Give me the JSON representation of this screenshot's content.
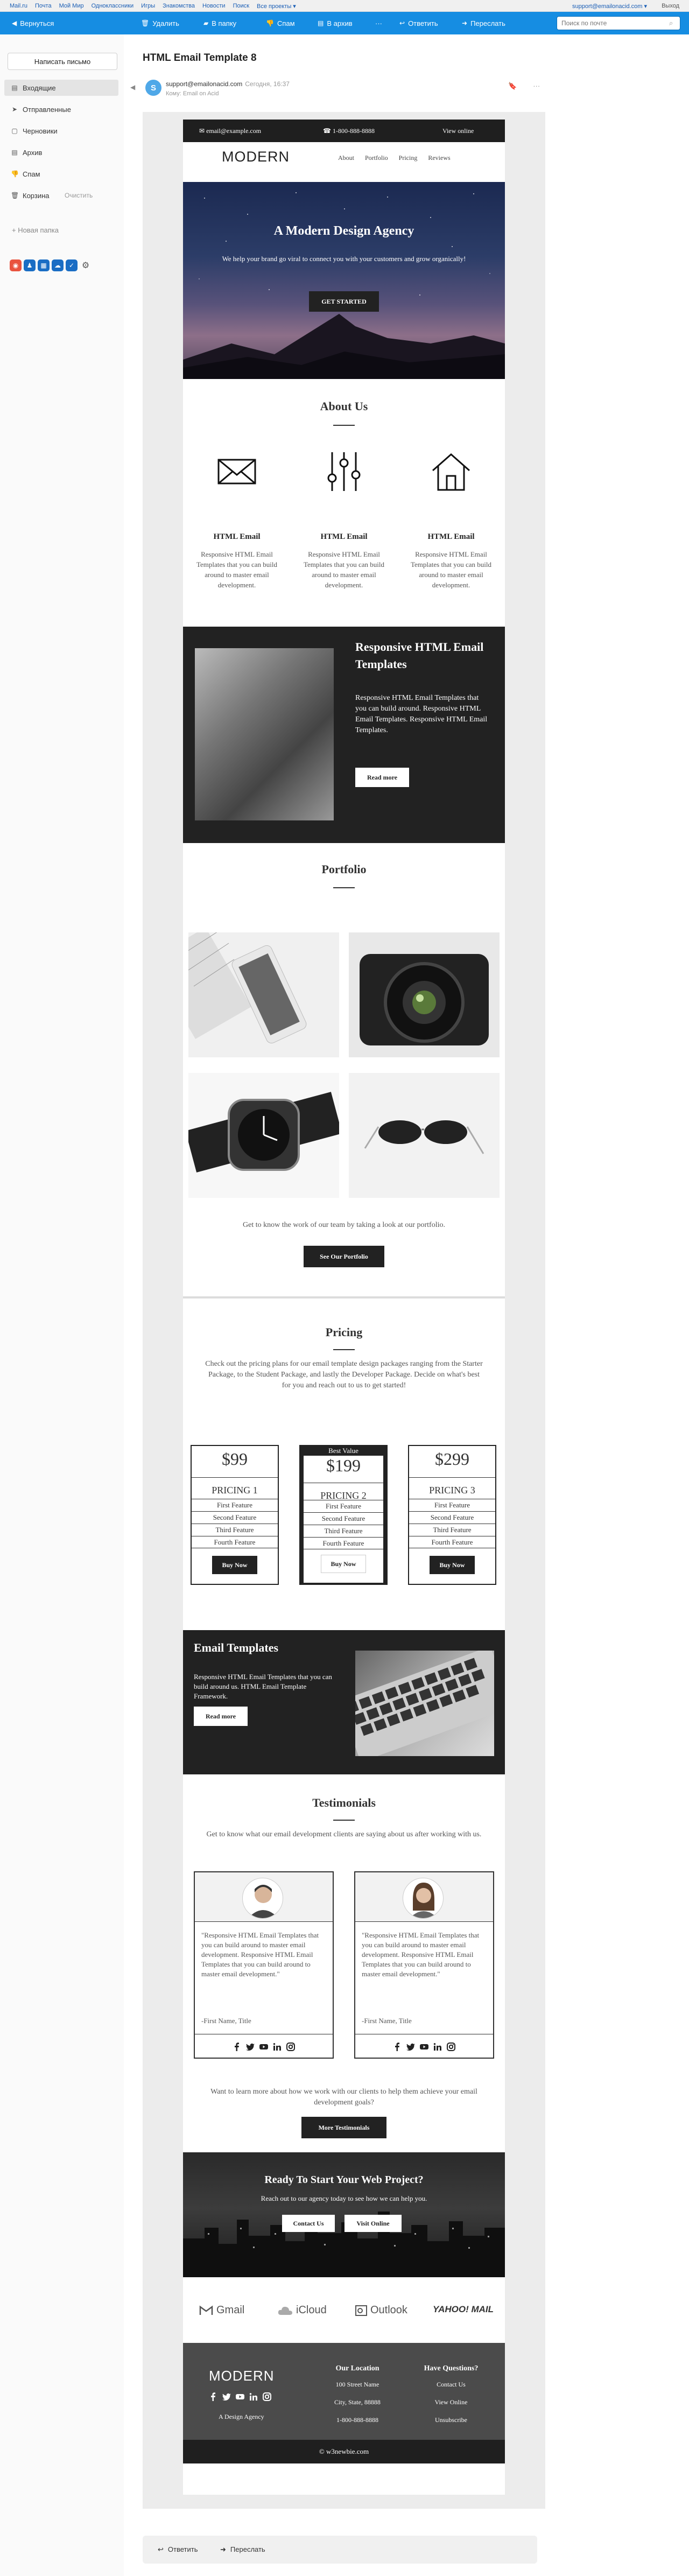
{
  "portal": {
    "links": [
      "Mail.ru",
      "Почта",
      "Мой Мир",
      "Одноклассники",
      "Игры",
      "Знакомства",
      "Новости",
      "Поиск",
      "Все проекты ▾"
    ],
    "user": "support@emailonacid.com ▾",
    "exit": "Выход"
  },
  "toolbar": {
    "back": "Вернуться",
    "delete": "Удалить",
    "to_folder": "В папку",
    "spam": "Спам",
    "archive": "В архив",
    "more": "···",
    "reply": "Ответить",
    "forward": "Переслать",
    "search_placeholder": "Поиск по почте"
  },
  "sidebar": {
    "compose": "Написать письмо",
    "folders": [
      {
        "label": "Входящие",
        "icon": "inbox-icon"
      },
      {
        "label": "Отправленные",
        "icon": "sent-icon"
      },
      {
        "label": "Черновики",
        "icon": "drafts-icon"
      },
      {
        "label": "Архив",
        "icon": "archive-icon"
      },
      {
        "label": "Спам",
        "icon": "spam-icon"
      },
      {
        "label": "Корзина",
        "icon": "trash-icon"
      }
    ],
    "clear": "Очистить",
    "new_folder": "Новая папка"
  },
  "message": {
    "subject": "HTML Email Template 8",
    "avatar_letter": "S",
    "sender": "support@emailonacid.com",
    "date": "Сегодня, 16:37",
    "recipient": "Кому: Email on Acid"
  },
  "email": {
    "topbar": {
      "email": "email@example.com",
      "phone": "1-800-888-8888",
      "view_online": "View online"
    },
    "logo": "MODERN",
    "nav": [
      "About",
      "Portfolio",
      "Pricing",
      "Reviews"
    ],
    "hero": {
      "title": "A Modern Design Agency",
      "text": "We help your brand go viral to connect you with your customers and grow organically!",
      "button": "GET STARTED"
    },
    "about": {
      "title": "About Us",
      "features": [
        {
          "title": "HTML Email",
          "text": "Responsive HTML Email Templates that you can build around to master email development."
        },
        {
          "title": "HTML Email",
          "text": "Responsive HTML Email Templates that you can build around to master email development."
        },
        {
          "title": "HTML Email",
          "text": "Responsive HTML Email Templates that you can build around to master email development."
        }
      ]
    },
    "responsive": {
      "title": "Responsive HTML Email Templates",
      "text": "Responsive HTML Email Templates that you can build around. Responsive HTML Email Templates. Responsive HTML Email Templates.",
      "button": "Read more"
    },
    "portfolio": {
      "title": "Portfolio",
      "text": "Get to know the work of our team by taking a look at our portfolio.",
      "button": "See Our Portfolio"
    },
    "pricing": {
      "title": "Pricing",
      "text": "Check out the pricing plans for our email template design packages ranging from the Starter Package, to the Student Package, and lastly the Developer Package. Decide on what's best for you and reach out to us to get started!",
      "best_value": "Best Value",
      "plans": [
        {
          "price": "$99",
          "name": "PRICING 1",
          "features": [
            "First Feature",
            "Second Feature",
            "Third Feature",
            "Fourth Feature"
          ],
          "button": "Buy Now"
        },
        {
          "price": "$199",
          "name": "PRICING 2",
          "features": [
            "First Feature",
            "Second Feature",
            "Third Feature",
            "Fourth Feature"
          ],
          "button": "Buy Now"
        },
        {
          "price": "$299",
          "name": "PRICING 3",
          "features": [
            "First Feature",
            "Second Feature",
            "Third Feature",
            "Fourth Feature"
          ],
          "button": "Buy Now"
        }
      ]
    },
    "email_templates": {
      "title": "Email Templates",
      "text": "Responsive HTML Email Templates that you can build around us. HTML Email Template Framework.",
      "button": "Read more"
    },
    "testimonials": {
      "title": "Testimonials",
      "text": "Get to know what our email development clients are saying about us after working with us.",
      "cards": [
        {
          "quote": "\"Responsive HTML Email Templates that you can build around to master email development. Responsive HTML Email Templates that you can build around to master email development.\"",
          "who": "-First Name, Title"
        },
        {
          "quote": "\"Responsive HTML Email Templates that you can build around to master email development. Responsive HTML Email Templates that you can build around to master email development.\"",
          "who": "-First Name, Title"
        }
      ],
      "tail": "Want to learn more about how we work with our clients to help them achieve your email development goals?",
      "button": "More Testimonials"
    },
    "cta": {
      "title": "Ready To Start Your Web Project?",
      "text": "Reach out to our agency today to see how we can help you.",
      "contact": "Contact Us",
      "visit": "Visit Online"
    },
    "brands": [
      "Gmail",
      "iCloud",
      "Outlook",
      "YAHOO! MAIL"
    ],
    "footer": {
      "logo": "MODERN",
      "tagline": "A Design Agency",
      "location_title": "Our Location",
      "street": "100 Street Name",
      "city": "City, State, 88888",
      "phone": "1-800-888-8888",
      "questions_title": "Have Questions?",
      "contact": "Contact Us",
      "view_online": "View Online",
      "unsubscribe": "Unsubscribe"
    },
    "copyright": "© w3newbie.com"
  },
  "replybar": {
    "reply": "Ответить",
    "forward": "Переслать"
  },
  "colors": {
    "toolbar": "#168de2",
    "email_dark": "#222222",
    "footer": "#4b4b4b"
  }
}
